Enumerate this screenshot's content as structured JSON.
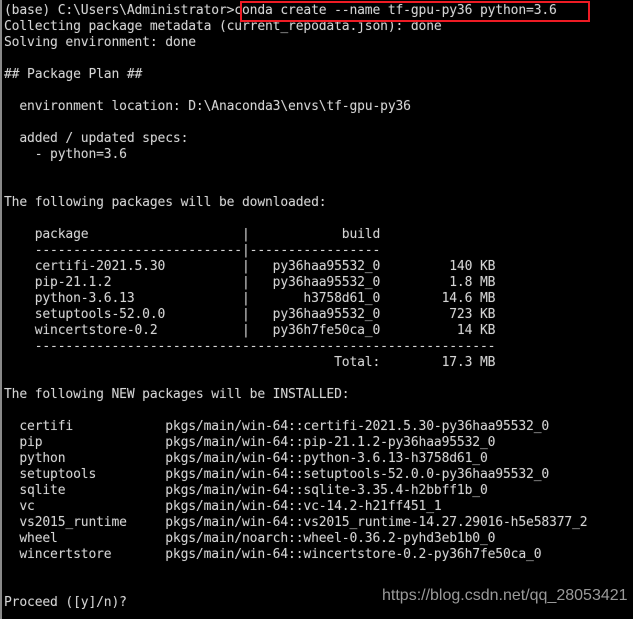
{
  "window": {
    "title": "Anaconda Prompt",
    "background_color": "#000000",
    "text_color": "#d4d4d4",
    "highlight_color": "#ee1b24"
  },
  "prompt": {
    "prefix": "(base) C:\\Users\\Administrator>",
    "command": "conda create --name tf-gpu-py36 python=3.6",
    "full_line": "(base) C:\\Users\\Administrator>conda create --name tf-gpu-py36 python=3.6"
  },
  "status_lines": [
    "Collecting package metadata (current_repodata.json): done",
    "Solving environment: done"
  ],
  "package_plan": {
    "heading": "## Package Plan ##",
    "environment_location_label": "environment location:",
    "environment_location_value": "D:\\Anaconda3\\envs\\tf-gpu-py36",
    "specs_label": "added / updated specs:",
    "specs": [
      "- python=3.6"
    ]
  },
  "download_section": {
    "heading": "The following packages will be downloaded:",
    "columns": [
      "package",
      "build"
    ],
    "separator_left": "------------------------",
    "separator_right": "-----------------",
    "rows": [
      {
        "package": "certifi-2021.5.30",
        "build": "py36haa95532_0",
        "size": "140 KB"
      },
      {
        "package": "pip-21.1.2",
        "build": "py36haa95532_0",
        "size": "1.8 MB"
      },
      {
        "package": "python-3.6.13",
        "build": "h3758d61_0",
        "size": "14.6 MB"
      },
      {
        "package": "setuptools-52.0.0",
        "build": "py36haa95532_0",
        "size": "723 KB"
      },
      {
        "package": "wincertstore-0.2",
        "build": "py36h7fe50ca_0",
        "size": "14 KB"
      }
    ],
    "total_label": "Total:",
    "total_size": "17.3 MB",
    "total_separator": "------------------------------------------------------------"
  },
  "install_section": {
    "heading": "The following NEW packages will be INSTALLED:",
    "rows": [
      {
        "name": "certifi",
        "spec": "pkgs/main/win-64::certifi-2021.5.30-py36haa95532_0"
      },
      {
        "name": "pip",
        "spec": "pkgs/main/win-64::pip-21.1.2-py36haa95532_0"
      },
      {
        "name": "python",
        "spec": "pkgs/main/win-64::python-3.6.13-h3758d61_0"
      },
      {
        "name": "setuptools",
        "spec": "pkgs/main/win-64::setuptools-52.0.0-py36haa95532_0"
      },
      {
        "name": "sqlite",
        "spec": "pkgs/main/win-64::sqlite-3.35.4-h2bbff1b_0"
      },
      {
        "name": "vc",
        "spec": "pkgs/main/win-64::vc-14.2-h21ff451_1"
      },
      {
        "name": "vs2015_runtime",
        "spec": "pkgs/main/win-64::vs2015_runtime-14.27.29016-h5e58377_2"
      },
      {
        "name": "wheel",
        "spec": "pkgs/main/noarch::wheel-0.36.2-pyhd3eb1b0_0"
      },
      {
        "name": "wincertstore",
        "spec": "pkgs/main/win-64::wincertstore-0.2-py36h7fe50ca_0"
      }
    ]
  },
  "proceed_prompt": "Proceed ([y]/n)? ",
  "watermark": "https://blog.csdn.net/qq_28053421",
  "console_body": "(base) C:\\Users\\Administrator>conda create --name tf-gpu-py36 python=3.6\nCollecting package metadata (current_repodata.json): done\nSolving environment: done\n\n## Package Plan ##\n\n  environment location: D:\\Anaconda3\\envs\\tf-gpu-py36\n\n  added / updated specs:\n    - python=3.6\n\n\nThe following packages will be downloaded:\n\n    package                    |            build\n    ---------------------------|-----------------\n    certifi-2021.5.30          |   py36haa95532_0         140 KB\n    pip-21.1.2                 |   py36haa95532_0         1.8 MB\n    python-3.6.13              |       h3758d61_0        14.6 MB\n    setuptools-52.0.0          |   py36haa95532_0         723 KB\n    wincertstore-0.2           |   py36h7fe50ca_0          14 KB\n    ------------------------------------------------------------\n                                           Total:        17.3 MB\n\nThe following NEW packages will be INSTALLED:\n\n  certifi            pkgs/main/win-64::certifi-2021.5.30-py36haa95532_0\n  pip                pkgs/main/win-64::pip-21.1.2-py36haa95532_0\n  python             pkgs/main/win-64::python-3.6.13-h3758d61_0\n  setuptools         pkgs/main/win-64::setuptools-52.0.0-py36haa95532_0\n  sqlite             pkgs/main/win-64::sqlite-3.35.4-h2bbff1b_0\n  vc                 pkgs/main/win-64::vc-14.2-h21ff451_1\n  vs2015_runtime     pkgs/main/win-64::vs2015_runtime-14.27.29016-h5e58377_2\n  wheel              pkgs/main/noarch::wheel-0.36.2-pyhd3eb1b0_0\n  wincertstore       pkgs/main/win-64::wincertstore-0.2-py36h7fe50ca_0\n\n\nProceed ([y]/n)? "
}
